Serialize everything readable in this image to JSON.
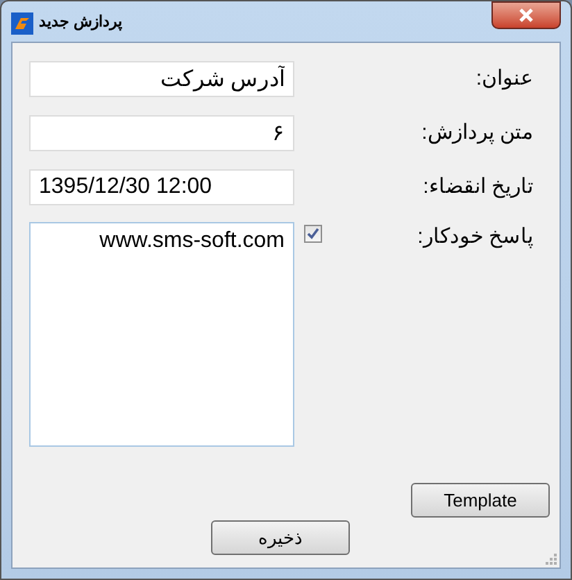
{
  "window": {
    "title": "پردازش جدید"
  },
  "fields": [
    {
      "label": "عنوان:",
      "value": "آدرس شرکت",
      "kind": "rtl"
    },
    {
      "label": "متن پردازش:",
      "value": "۶",
      "kind": "rtl"
    },
    {
      "label": "تاریخ انقضاء:",
      "value": "1395/12/30 12:00",
      "kind": "ltr"
    }
  ],
  "auto_reply": {
    "label": "پاسخ خودکار:",
    "checked": true,
    "message": "www.sms-soft.com"
  },
  "buttons": [
    {
      "label": "Template",
      "kind": "template"
    },
    {
      "label": "ذخیره",
      "kind": "save"
    }
  ]
}
